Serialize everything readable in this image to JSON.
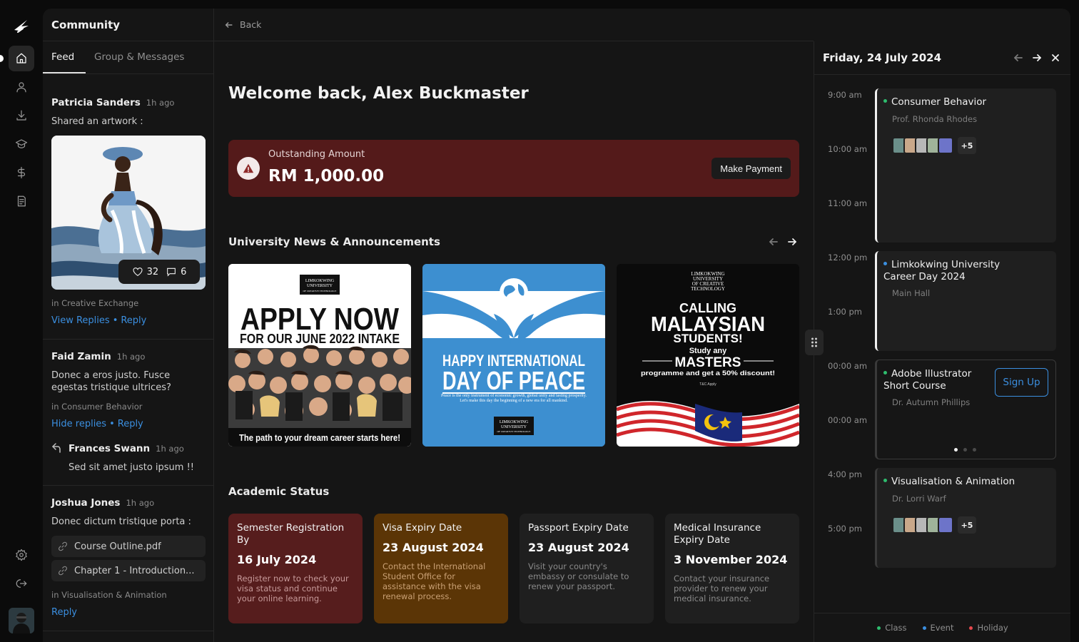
{
  "community": {
    "title": "Community",
    "tabs": [
      "Feed",
      "Group & Messages"
    ],
    "posts": [
      {
        "name": "Patricia Sanders",
        "time": "1h ago",
        "text": "Shared an artwork :",
        "likes": "32",
        "comments": "6",
        "group": "in Creative Exchange",
        "link1": "View Replies",
        "link2": "Reply"
      },
      {
        "name": "Faid Zamin",
        "time": "1h ago",
        "text": "Donec a eros justo. Fusce egestas tristique ultrices?",
        "group": "in Consumer Behavior",
        "link1": "Hide replies",
        "link2": "Reply",
        "reply": {
          "name": "Frances Swann",
          "time": "1h ago",
          "text": "Sed sit amet justo ipsum !!"
        }
      },
      {
        "name": "Joshua Jones",
        "time": "1h ago",
        "text": "Donec dictum tristique porta :",
        "attachments": [
          "Course Outline.pdf",
          "Chapter 1 - Introduction..."
        ],
        "group": "in Visualisation & Animation",
        "link2": "Reply"
      }
    ]
  },
  "center": {
    "back": "Back",
    "welcome": "Welcome back, Alex Buckmaster",
    "alert": {
      "label": "Outstanding Amount",
      "amount": "RM 1,000.00",
      "button": "Make Payment"
    },
    "news_title": "University News & Announcements",
    "news": [
      {
        "logo": [
          "LIMKOKWING",
          "UNIVERSITY",
          "OF CREATIVE TECHNOLOGY"
        ],
        "headline": "APPLY NOW",
        "sub": "FOR OUR JUNE 2022 INTAKE",
        "footer": "The path to your dream career starts here!"
      },
      {
        "headline1": "HAPPY INTERNATIONAL",
        "headline2": "DAY OF PEACE",
        "text": "Peace is the only instrument of economic growth, global unity and lasting prosperity. Let's make this day the beginning of a new era for all mankind.",
        "logo": [
          "LIMKOKWING",
          "UNIVERSITY",
          "OF CREATIVE TECHNOLOGY"
        ]
      },
      {
        "logo": [
          "LIMKOKWING",
          "UNIVERSITY",
          "OF CREATIVE",
          "TECHNOLOGY"
        ],
        "l1": "CALLING",
        "l2": "MALAYSIAN",
        "l3": "STUDENTS!",
        "l4": "Study any",
        "l5": "MASTERS",
        "l6": "programme and get a 50% discount!",
        "tc": "T&C Apply"
      }
    ],
    "academic_title": "Academic Status",
    "status": [
      {
        "title": "Semester Registration By",
        "date": "16 July 2024",
        "desc": "Register now to check your visa status and continue your online learning.",
        "bg": "#561d1d",
        "desc_color": "#c79a9a"
      },
      {
        "title": "Visa Expiry Date",
        "date": "23 August 2024",
        "desc": "Contact the International Student Office for assistance with the visa renewal process.",
        "bg": "#5b3506",
        "desc_color": "#c9a074"
      },
      {
        "title": "Passport Expiry Date",
        "date": "23 August 2024",
        "desc": "Visit your country's embassy or consulate to renew your passport.",
        "bg": "#1f1f1f",
        "desc_color": "#8a8a8a"
      },
      {
        "title": "Medical Insurance Expiry Date",
        "date": "3 November 2024",
        "desc": "Contact your insurance provider to renew your medical insurance.",
        "bg": "#1f1f1f",
        "desc_color": "#8a8a8a"
      }
    ]
  },
  "calendar": {
    "date": "Friday, 24 July 2024",
    "hours": [
      "9:00 am",
      "10:00 am",
      "11:00 am",
      "12:00 pm",
      "1:00 pm",
      "00:00 am",
      "00:00 am",
      "4:00 pm",
      "5:00 pm"
    ],
    "events": [
      {
        "title": "Consumer Behavior",
        "sub": "Prof. Rhonda Rhodes",
        "more": "+5",
        "dot": "#2ebd6e"
      },
      {
        "title": "Limkokwing University Career Day 2024",
        "sub": "Main Hall",
        "dot": "#3b8fe0"
      },
      {
        "title": "Adobe Illustrator Short Course",
        "sub": "Dr. Autumn Phillips",
        "button": "Sign Up",
        "dot": "#2ebd6e"
      },
      {
        "title": "Visualisation & Animation",
        "sub": "Dr. Lorri Warf",
        "more": "+5",
        "dot": "#2ebd6e"
      }
    ],
    "legend": [
      {
        "label": "Class",
        "color": "#2ebd6e"
      },
      {
        "label": "Event",
        "color": "#3b8fe0"
      },
      {
        "label": "Holiday",
        "color": "#e5484d"
      }
    ]
  }
}
